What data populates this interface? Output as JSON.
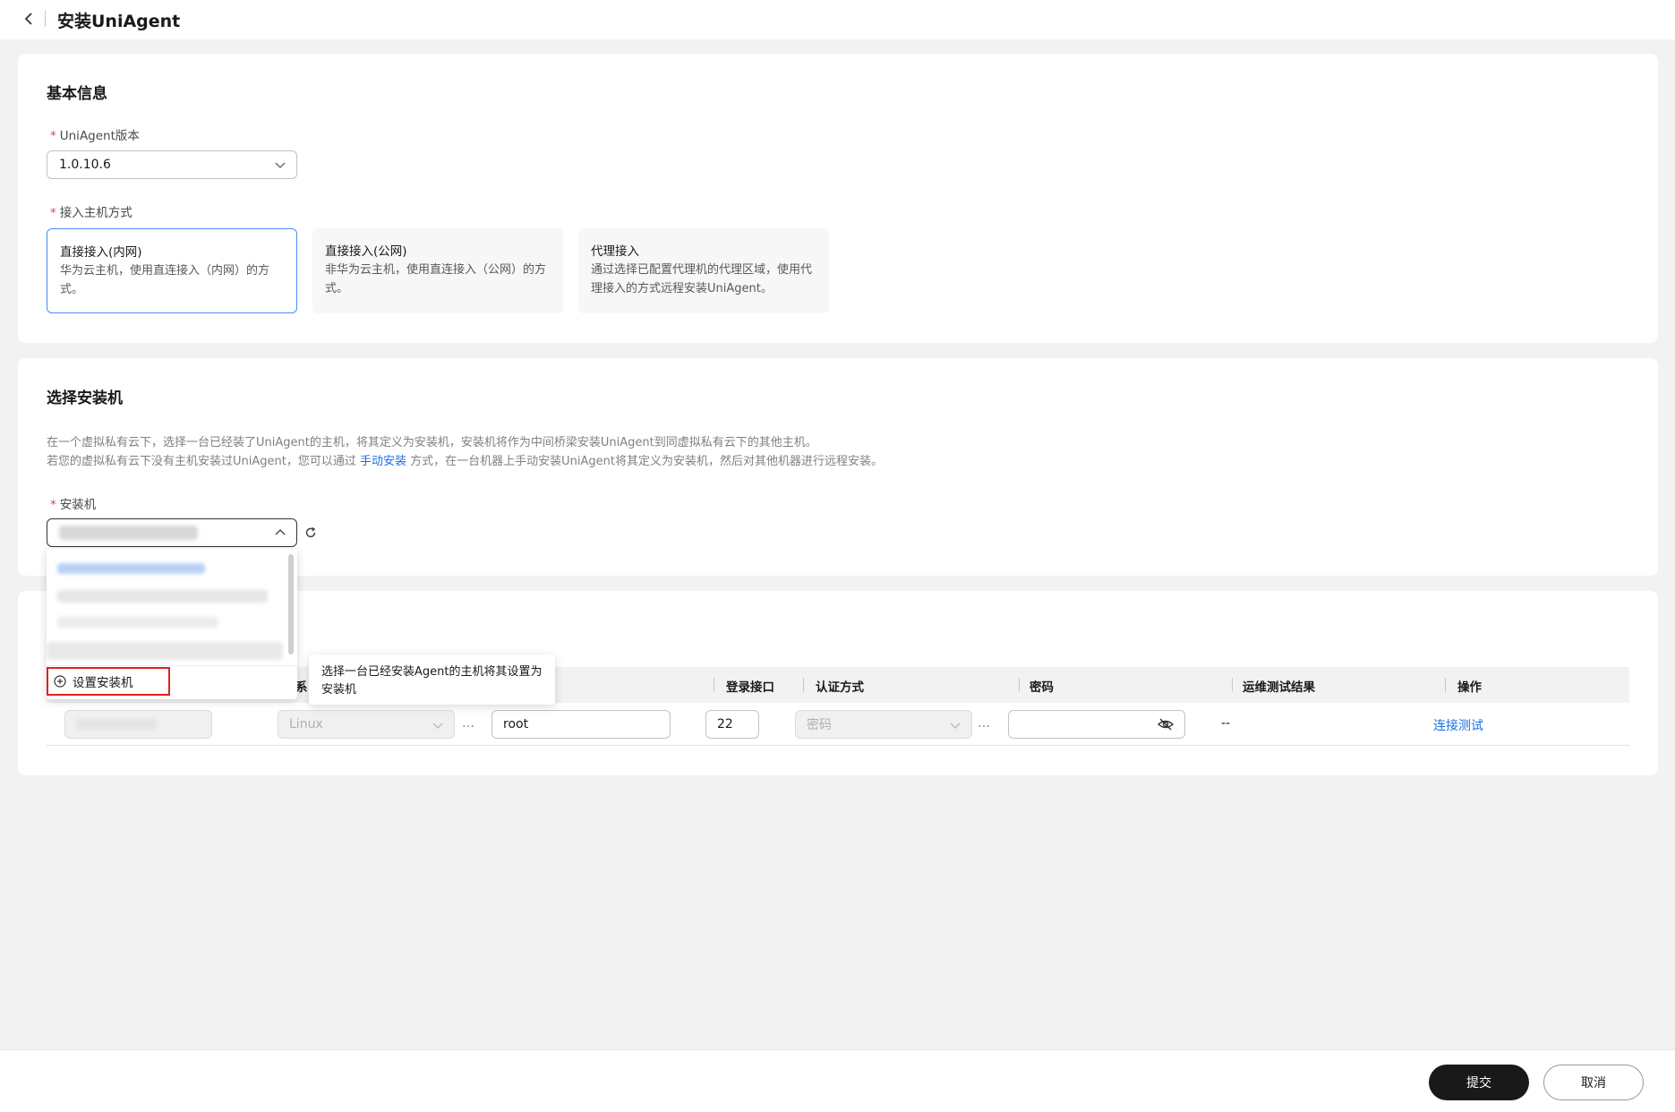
{
  "header": {
    "title": "安装UniAgent",
    "back_icon": "chevron-left-icon"
  },
  "basic_info": {
    "section_title": "基本信息",
    "version_label": "UniAgent版本",
    "version_value": "1.0.10.6",
    "access_label": "接入主机方式",
    "modes": [
      {
        "title": "直接接入(内网)",
        "desc": "华为云主机，使用直连接入（内网）的方式。",
        "selected": true
      },
      {
        "title": "直接接入(公网)",
        "desc": "非华为云主机，使用直连接入（公网）的方式。",
        "selected": false
      },
      {
        "title": "代理接入",
        "desc": "通过选择已配置代理机的代理区域，使用代理接入的方式远程安装UniAgent。",
        "selected": false
      }
    ]
  },
  "installer": {
    "section_title": "选择安装机",
    "desc_line1": "在一个虚拟私有云下，选择一台已经装了UniAgent的主机，将其定义为安装机，安装机将作为中间桥梁安装UniAgent到同虚拟私有云下的其他主机。",
    "desc_line2_before": "若您的虚拟私有云下没有主机安装过UniAgent，您可以通过 ",
    "desc_line2_link": "手动安装",
    "desc_line2_after": " 方式，在一台机器上手动安装UniAgent将其定义为安装机，然后对其他机器进行远程安装。",
    "installer_label": "安装机",
    "refresh_icon": "refresh-icon",
    "dropdown_action": "设置安装机",
    "tooltip": "选择一台已经安装Agent的主机将其设置为安装机"
  },
  "table": {
    "headers": [
      "系",
      "登录接口",
      "认证方式",
      "密码",
      "运维测试结果",
      "操作"
    ],
    "row": {
      "os": "Linux",
      "user": "root",
      "port": "22",
      "auth": "密码",
      "password": "",
      "test_result": "--",
      "action": "连接测试"
    }
  },
  "footer": {
    "submit": "提交",
    "cancel": "取消"
  },
  "colors": {
    "accent": "#1e6fe0",
    "selected_border": "#4a8cf7",
    "required": "#e54545",
    "primary_btn": "#191919"
  }
}
